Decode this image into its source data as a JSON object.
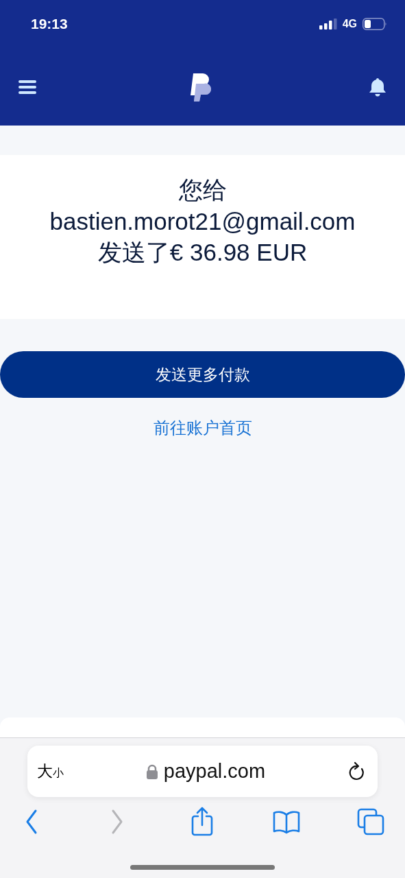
{
  "status_bar": {
    "time": "19:13",
    "network": "4G"
  },
  "message_lines": [
    "您给",
    "bastien.morot21@gmail.com",
    "发送了€ 36.98 EUR"
  ],
  "primary_button": "发送更多付款",
  "home_link": "前往账户首页",
  "browser": {
    "text_size": "大",
    "text_size_small": "小",
    "url": "paypal.com",
    "toolbar": [
      {
        "kind": "back",
        "disabled": false
      },
      {
        "kind": "forward",
        "disabled": true
      },
      {
        "kind": "share",
        "disabled": false
      },
      {
        "kind": "bookmarks",
        "disabled": false
      },
      {
        "kind": "tabs",
        "disabled": false
      }
    ]
  }
}
